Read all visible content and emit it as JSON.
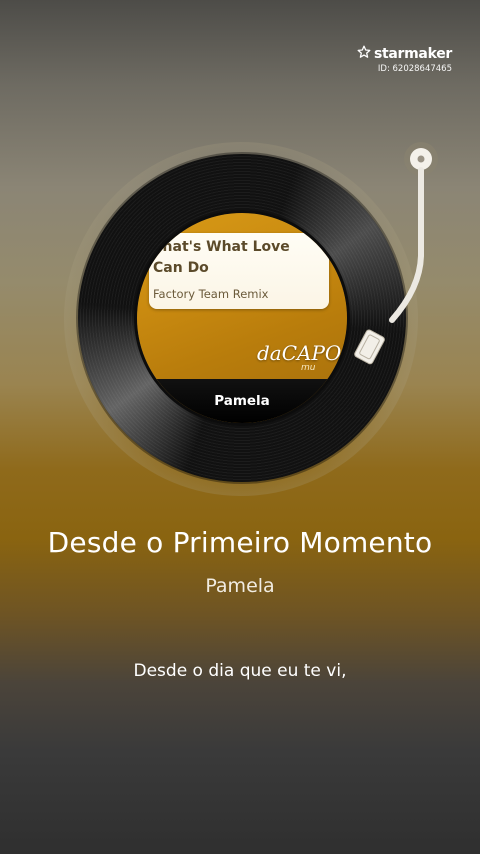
{
  "brand": {
    "name": "starmaker",
    "id_text": "ID: 62028647465"
  },
  "record": {
    "label_song_title": "That's What Love Can Do",
    "label_remix": "Factory Team Remix",
    "label_publisher": "daCAPO",
    "label_publisher_sub": "mu",
    "label_artist": "Pamela"
  },
  "now_playing": {
    "title": "Desde o Primeiro Momento",
    "artist": "Pamela",
    "lyric_line": "Desde o dia que eu te vi,"
  },
  "colors": {
    "accent_gold": "#8f6a1b",
    "label_gold": "#c98a10"
  }
}
